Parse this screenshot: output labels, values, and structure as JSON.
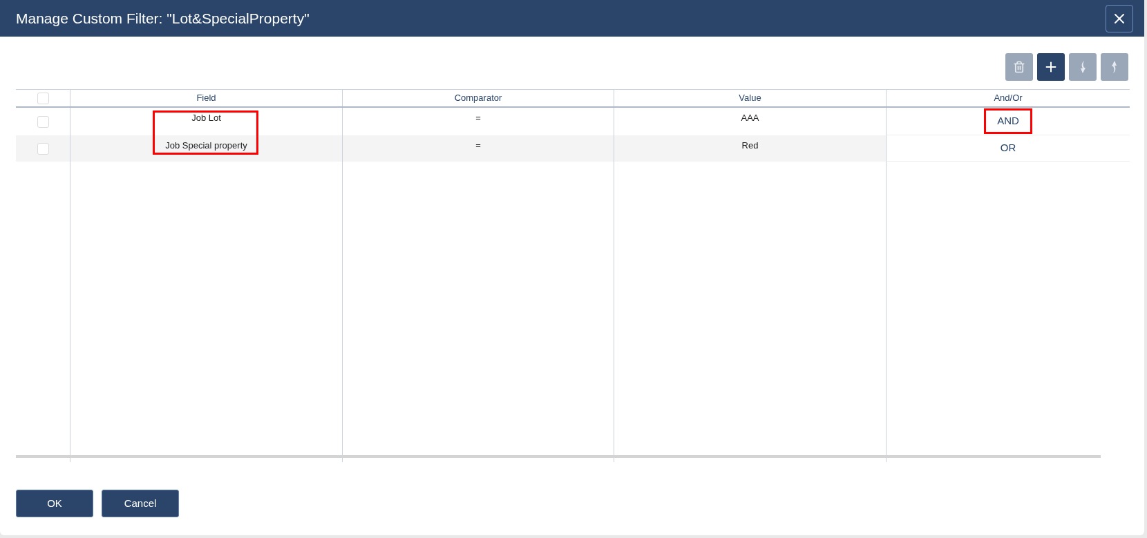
{
  "dialog": {
    "title": "Manage Custom Filter: \"Lot&SpecialProperty\""
  },
  "toolbar": [
    {
      "kind": "delete",
      "disabled": true
    },
    {
      "kind": "add",
      "disabled": false
    },
    {
      "kind": "down",
      "disabled": true
    },
    {
      "kind": "up",
      "disabled": true
    }
  ],
  "table": {
    "header_checked": false,
    "columns": [
      "Field",
      "Comparator",
      "Value",
      "And/Or"
    ],
    "field_highlight": true,
    "rows": [
      {
        "checked": false,
        "field": "Job Lot",
        "comparator": "=",
        "value": "AAA",
        "and_or": "AND",
        "and_or_highlight": true
      },
      {
        "checked": false,
        "field": "Job Special property",
        "comparator": "=",
        "value": "Red",
        "and_or": "OR",
        "and_or_highlight": false
      }
    ]
  },
  "buttons": [
    "OK",
    "Cancel"
  ]
}
